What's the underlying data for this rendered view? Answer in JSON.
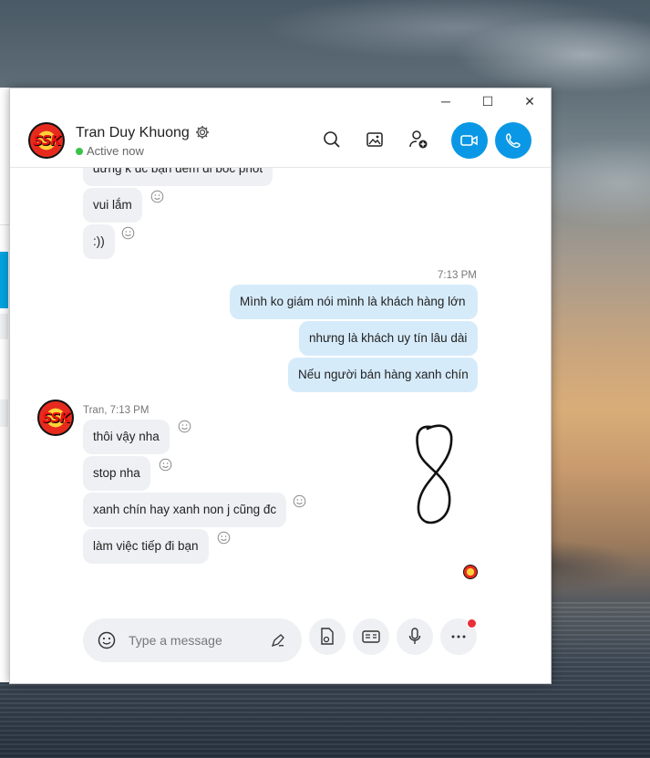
{
  "window": {
    "minimize": "─",
    "maximize": "☐",
    "close": "✕"
  },
  "header": {
    "avatar_text": "SSK",
    "name": "Tran Duy Khuong",
    "status": "Active now",
    "icons": [
      "search-icon",
      "gallery-icon",
      "add-person-icon",
      "video-call-icon",
      "audio-call-icon"
    ],
    "accent": "#0a98e6"
  },
  "messages": {
    "incoming_top": [
      "đừng k dc bạn đem đi bóc phốt",
      "vui lắm",
      ":))"
    ],
    "outgoing_time": "7:13 PM",
    "outgoing": [
      "Mình ko giám nói mình là khách hàng lớn",
      "nhưng là khách uy tín lâu dài",
      "Nếu người bán hàng xanh chín"
    ],
    "incoming_meta": "Tran, 7:13 PM",
    "incoming": [
      "thôi vậy nha",
      "stop nha",
      "xanh chín hay xanh non j cũng đc",
      "làm việc tiếp đi bạn"
    ]
  },
  "composer": {
    "placeholder": "Type a message",
    "icons": [
      "emoji-icon",
      "pen-icon",
      "file-icon",
      "contact-card-icon",
      "microphone-icon",
      "more-icon"
    ]
  },
  "colors": {
    "incoming_bubble": "#eef0f3",
    "outgoing_bubble": "#d6ebfa",
    "online": "#3ac24a",
    "notification": "#e8303a"
  }
}
